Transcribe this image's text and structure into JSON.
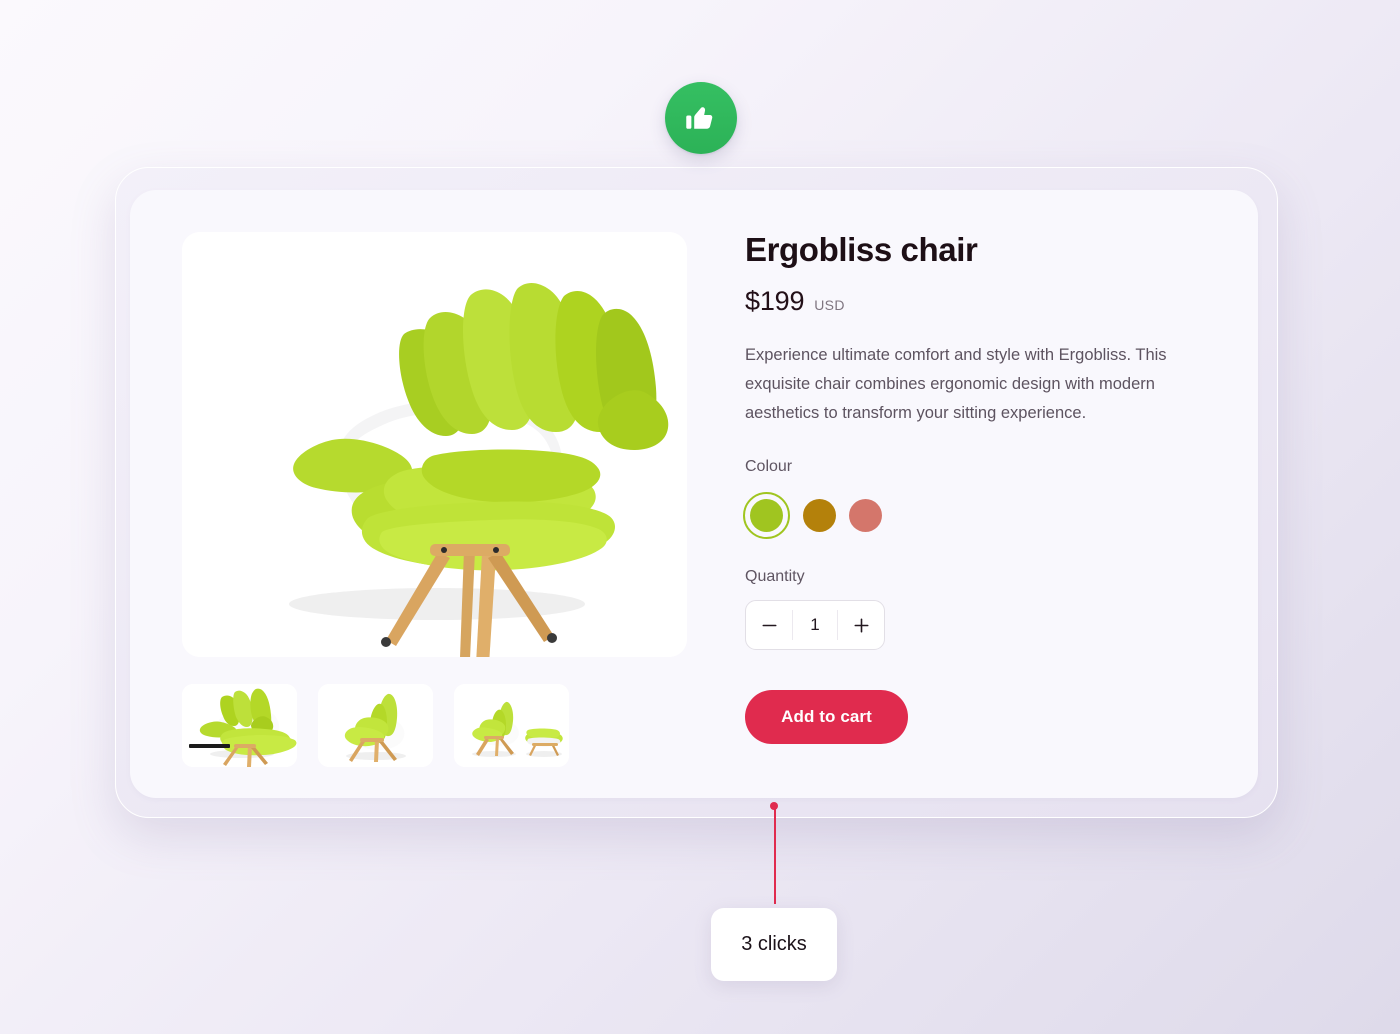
{
  "badge": {
    "icon": "thumbs-up-icon",
    "color": "#2fb85d"
  },
  "product": {
    "title": "Ergobliss chair",
    "price": "$199",
    "currency": "USD",
    "description": "Experience ultimate comfort and style with Ergobliss. This exquisite chair combines ergonomic design with modern aesthetics to transform your sitting experience.",
    "colour": {
      "label": "Colour",
      "selected_index": 0,
      "options": [
        {
          "name": "lime-green",
          "hex": "#a0c520",
          "selected": true
        },
        {
          "name": "mustard-gold",
          "hex": "#b4810b",
          "selected": false
        },
        {
          "name": "terracotta-salmon",
          "hex": "#d4766b",
          "selected": false
        }
      ]
    },
    "quantity": {
      "label": "Quantity",
      "value": "1",
      "decrease_icon": "minus-icon",
      "increase_icon": "plus-icon"
    },
    "cta": {
      "label": "Add to cart",
      "color": "#e02b4e"
    },
    "gallery": {
      "main_image_alt": "green-lounge-chair-front-view",
      "thumbnails": [
        {
          "name": "thumbnail-front-view",
          "selected": true
        },
        {
          "name": "thumbnail-side-view",
          "selected": false
        },
        {
          "name": "thumbnail-with-ottoman",
          "selected": false
        }
      ]
    }
  },
  "annotation": {
    "label": "3 clicks",
    "color": "#e02b4e"
  }
}
